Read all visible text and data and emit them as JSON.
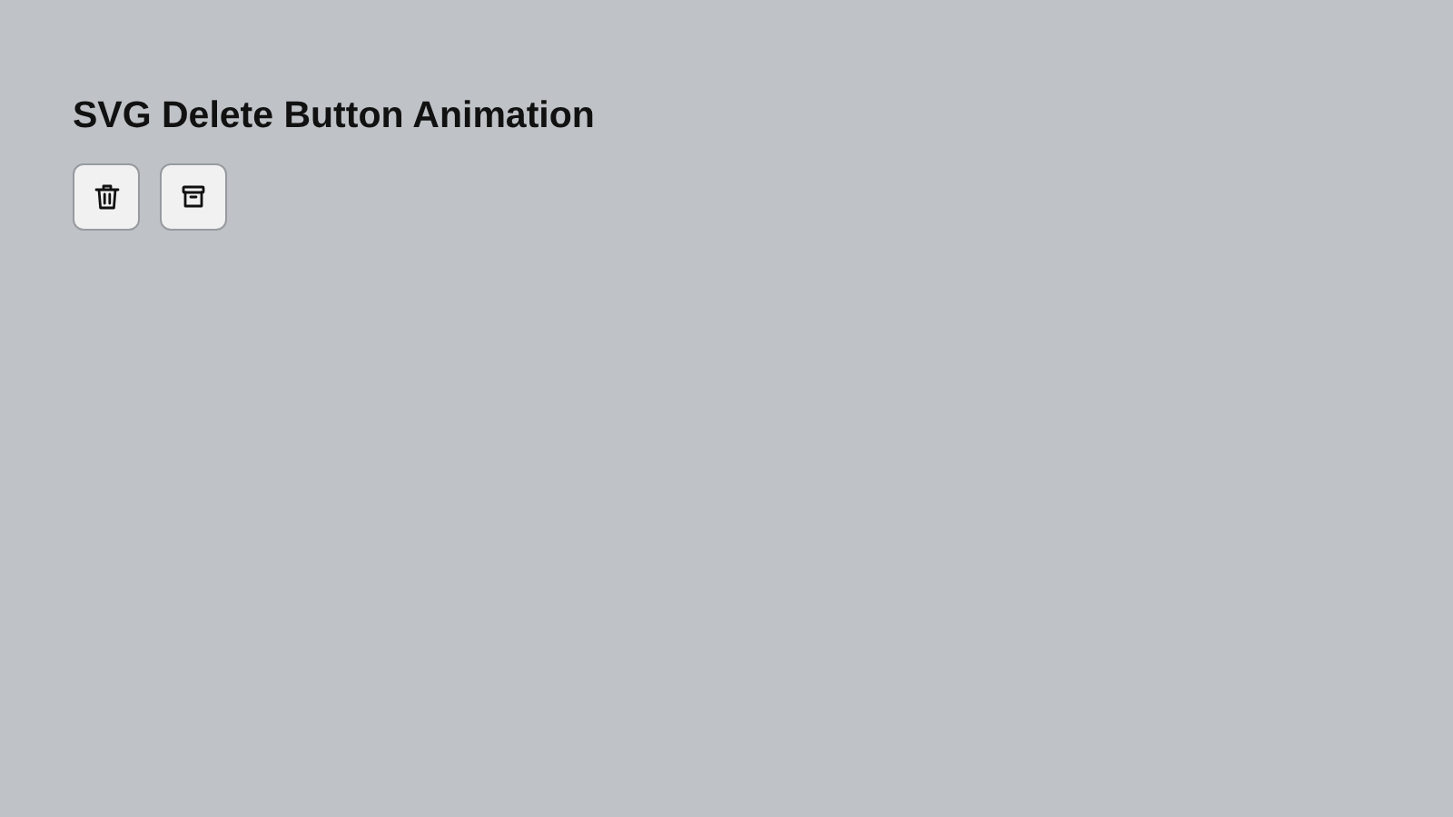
{
  "title": "SVG Delete Button Animation",
  "buttons": [
    {
      "kind": "trash"
    },
    {
      "kind": "archive"
    }
  ]
}
